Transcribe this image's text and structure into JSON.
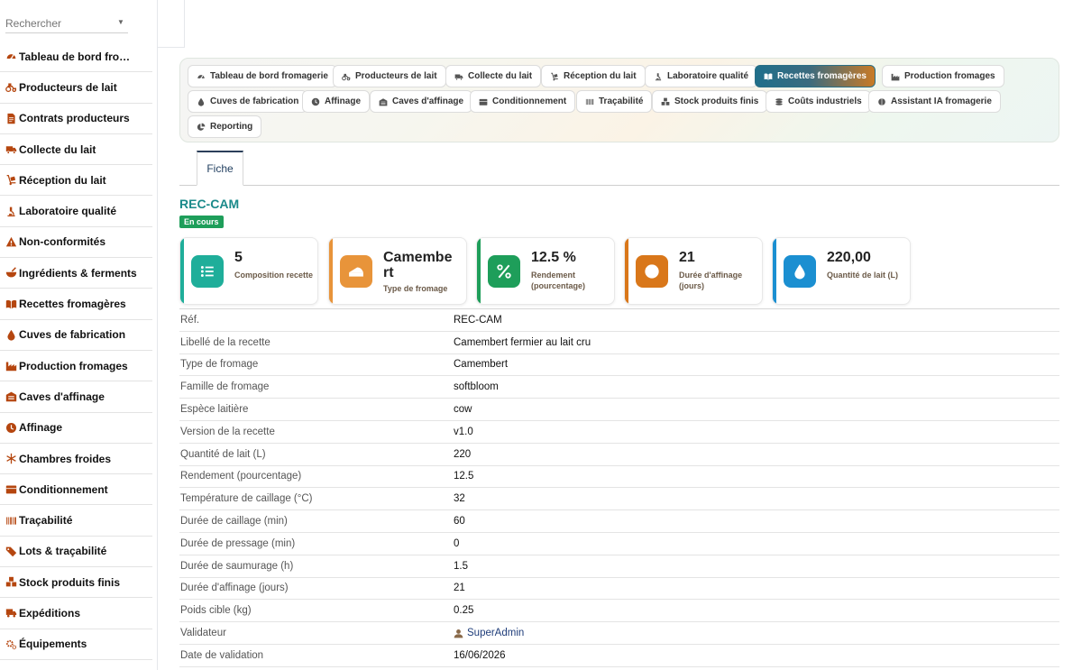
{
  "search": {
    "placeholder": "Rechercher"
  },
  "sidebar": {
    "items": [
      {
        "label": "Tableau de bord fro…",
        "icon": "gauge-icon"
      },
      {
        "label": "Producteurs de lait",
        "icon": "farm-icon"
      },
      {
        "label": "Contrats producteurs",
        "icon": "contract-icon"
      },
      {
        "label": "Collecte du lait",
        "icon": "truck-icon"
      },
      {
        "label": "Réception du lait",
        "icon": "dolly-icon"
      },
      {
        "label": "Laboratoire qualité",
        "icon": "microscope-icon"
      },
      {
        "label": "Non-conformités",
        "icon": "warning-icon"
      },
      {
        "label": "Ingrédients & ferments",
        "icon": "mortar-icon"
      },
      {
        "label": "Recettes fromagères",
        "icon": "book-icon"
      },
      {
        "label": "Cuves de fabrication",
        "icon": "drop-icon"
      },
      {
        "label": "Production fromages",
        "icon": "industry-icon"
      },
      {
        "label": "Caves d'affinage",
        "icon": "warehouse-icon"
      },
      {
        "label": "Affinage",
        "icon": "clock-icon"
      },
      {
        "label": "Chambres froides",
        "icon": "snowflake-icon"
      },
      {
        "label": "Conditionnement",
        "icon": "box-icon"
      },
      {
        "label": "Traçabilité",
        "icon": "barcode-icon"
      },
      {
        "label": "Lots & traçabilité",
        "icon": "tags-icon"
      },
      {
        "label": "Stock produits finis",
        "icon": "boxes-icon"
      },
      {
        "label": "Expéditions",
        "icon": "shipping-icon"
      },
      {
        "label": "Équipements",
        "icon": "cogs-icon"
      }
    ]
  },
  "nav": {
    "pills": [
      {
        "label": "Tableau de bord fromagerie",
        "icon": "gauge-icon"
      },
      {
        "label": "Producteurs de lait",
        "icon": "farm-icon"
      },
      {
        "label": "Collecte du lait",
        "icon": "truck-icon"
      },
      {
        "label": "Réception du lait",
        "icon": "dolly-icon"
      },
      {
        "label": "Laboratoire qualité",
        "icon": "microscope-icon"
      },
      {
        "label": "Recettes fromagères",
        "icon": "book-icon",
        "active": true
      },
      {
        "label": "Production fromages",
        "icon": "industry-icon"
      },
      {
        "label": "Cuves de fabrication",
        "icon": "drop-icon"
      },
      {
        "label": "Affinage",
        "icon": "clock-icon"
      },
      {
        "label": "Caves d'affinage",
        "icon": "warehouse-icon"
      },
      {
        "label": "Conditionnement",
        "icon": "box-icon"
      },
      {
        "label": "Traçabilité",
        "icon": "barcode-icon"
      },
      {
        "label": "Stock produits finis",
        "icon": "boxes-icon"
      },
      {
        "label": "Coûts industriels",
        "icon": "coins-icon"
      },
      {
        "label": "Assistant IA fromagerie",
        "icon": "brain-icon"
      },
      {
        "label": "Reporting",
        "icon": "chart-pie-icon"
      }
    ]
  },
  "tabs": {
    "fiche": "Fiche"
  },
  "record": {
    "title": "REC-CAM",
    "status": "En cours"
  },
  "colors": {
    "teal": "#1fae9a",
    "orange": "#e8943a",
    "green": "#1e9e5a",
    "amber": "#d9771a",
    "blue": "#1b8fd1"
  },
  "cards": [
    {
      "value": "5",
      "label": "Composition recette",
      "icon": "list-icon"
    },
    {
      "value": "Camembert",
      "label": "Type de fromage",
      "icon": "cheese-icon"
    },
    {
      "value": "12.5 %",
      "label": "Rendement (pourcentage)",
      "icon": "percent-icon"
    },
    {
      "value": "21",
      "label": "Durée d'affinage (jours)",
      "icon": "clock-icon"
    },
    {
      "value": "220,00",
      "label": "Quantité de lait (L)",
      "icon": "drop-icon"
    }
  ],
  "fields": [
    {
      "key": "Réf.",
      "value": "REC-CAM"
    },
    {
      "key": "Libellé de la recette",
      "value": "Camembert fermier au lait cru"
    },
    {
      "key": "Type de fromage",
      "value": "Camembert"
    },
    {
      "key": "Famille de fromage",
      "value": "softbloom"
    },
    {
      "key": "Espèce laitière",
      "value": "cow"
    },
    {
      "key": "Version de la recette",
      "value": "v1.0"
    },
    {
      "key": "Quantité de lait (L)",
      "value": "220"
    },
    {
      "key": "Rendement (pourcentage)",
      "value": "12.5"
    },
    {
      "key": "Température de caillage (°C)",
      "value": "32"
    },
    {
      "key": "Durée de caillage (min)",
      "value": "60"
    },
    {
      "key": "Durée de pressage (min)",
      "value": "0"
    },
    {
      "key": "Durée de saumurage (h)",
      "value": "1.5"
    },
    {
      "key": "Durée d'affinage (jours)",
      "value": "21"
    },
    {
      "key": "Poids cible (kg)",
      "value": "0.25"
    },
    {
      "key": "Validateur",
      "value": "SuperAdmin",
      "link": true,
      "icon": "user-icon"
    },
    {
      "key": "Date de validation",
      "value": "16/06/2026"
    }
  ]
}
